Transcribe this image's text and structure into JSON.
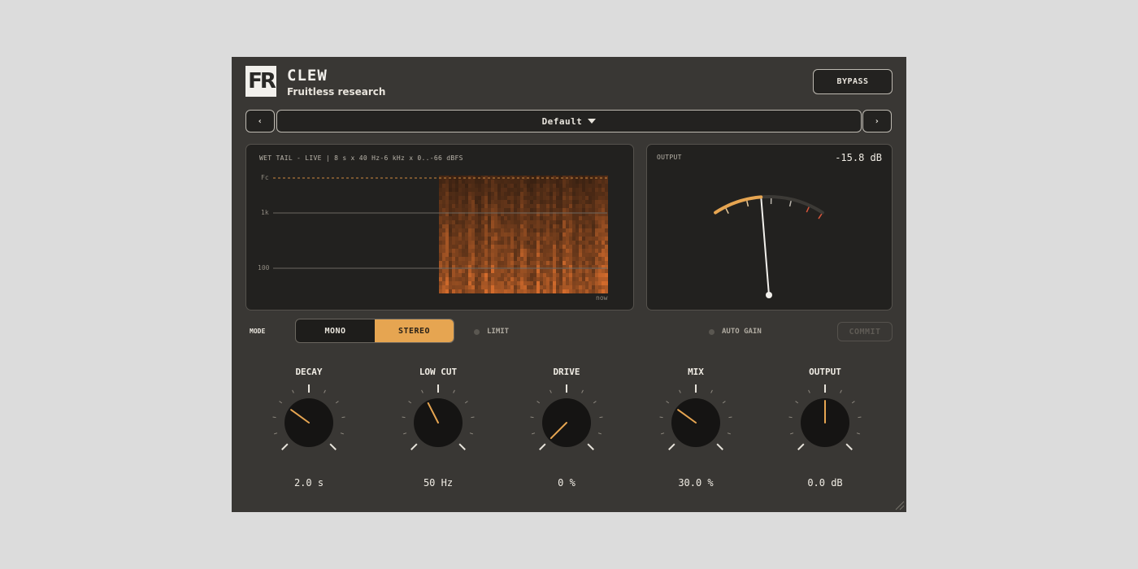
{
  "app": {
    "logo_text": "FR",
    "title": "CLEW",
    "subtitle": "Fruitless research",
    "bypass_label": "BYPASS"
  },
  "preset": {
    "prev_label": "‹",
    "next_label": "›",
    "name": "Default"
  },
  "spectrogram": {
    "label": "WET TAIL - LIVE  |  8 s x 40 Hz-6 kHz x 0..-66 dBFS",
    "y_labels": [
      "Fc",
      "1k",
      "100"
    ],
    "time_label": "now"
  },
  "output_meter": {
    "label": "OUTPUT",
    "readout": "-15.8 dB",
    "level_fraction": 0.43
  },
  "mode": {
    "label": "MODE",
    "options": [
      "MONO",
      "STEREO"
    ],
    "selected": "STEREO"
  },
  "toggles": {
    "limit_label": "LIMIT",
    "auto_gain_label": "AUTO GAIN",
    "commit_label": "COMMIT"
  },
  "knobs": [
    {
      "label": "DECAY",
      "value": "2.0 s",
      "fraction": 0.3
    },
    {
      "label": "LOW CUT",
      "value": "50 Hz",
      "fraction": 0.4
    },
    {
      "label": "DRIVE",
      "value": "0 %",
      "fraction": 0.0
    },
    {
      "label": "MIX",
      "value": "30.0 %",
      "fraction": 0.3
    },
    {
      "label": "OUTPUT",
      "value": "0.0 dB",
      "fraction": 0.5
    }
  ],
  "colors": {
    "accent": "#e6a551",
    "panel": "#393734",
    "screen": "#22211f",
    "warning": "#d8553a"
  }
}
